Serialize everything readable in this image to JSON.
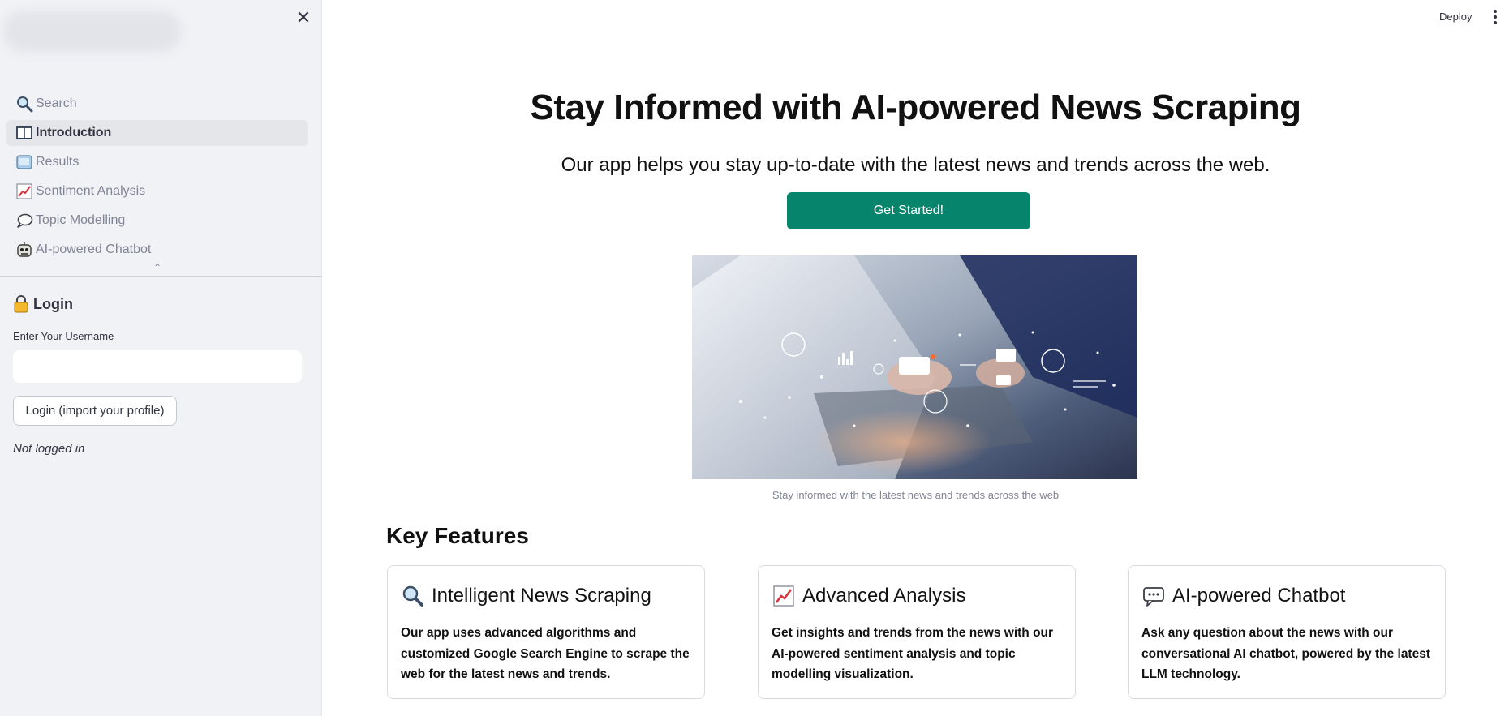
{
  "header": {
    "deploy_label": "Deploy",
    "menu_icon": "vertical-ellipsis-icon"
  },
  "sidebar": {
    "close_icon": "close-icon",
    "close_glyph": "✕",
    "nav_items": [
      {
        "label": "Search",
        "icon": "magnifier-icon",
        "active": false
      },
      {
        "label": "Introduction",
        "icon": "open-book-icon",
        "active": true
      },
      {
        "label": "Results",
        "icon": "chart-box-icon",
        "active": false
      },
      {
        "label": "Sentiment Analysis",
        "icon": "trend-chart-icon",
        "active": false
      },
      {
        "label": "Topic Modelling",
        "icon": "speech-bubble-icon",
        "active": false
      },
      {
        "label": "AI-powered Chatbot",
        "icon": "robot-icon",
        "active": false
      }
    ],
    "collapse_glyph": "⌃",
    "login": {
      "title": "Login",
      "title_icon": "lock-icon",
      "username_label": "Enter Your Username",
      "username_value": "",
      "button_label": "Login (import your profile)",
      "status": "Not logged in"
    }
  },
  "main": {
    "title": "Stay Informed with AI-powered News Scraping",
    "subtitle": "Our app helps you stay up-to-date with the latest news and trends across the web.",
    "cta_label": "Get Started!",
    "image_caption": "Stay informed with the latest news and trends across the web",
    "section_title": "Key Features",
    "features": [
      {
        "icon": "magnifier-icon",
        "title": "Intelligent News Scraping",
        "body": "Our app uses advanced algorithms and customized Google Search Engine to scrape the web for the latest news and trends."
      },
      {
        "icon": "trend-chart-icon",
        "title": "Advanced Analysis",
        "body": "Get insights and trends from the news with our AI-powered sentiment analysis and topic modelling visualization."
      },
      {
        "icon": "chat-bubble-icon",
        "title": "AI-powered Chatbot",
        "body": "Ask any question about the news with our conversational AI chatbot, powered by the latest LLM technology."
      }
    ]
  },
  "colors": {
    "sidebar_bg": "#f0f2f6",
    "primary_button": "#07856c",
    "muted_text": "#808495"
  }
}
